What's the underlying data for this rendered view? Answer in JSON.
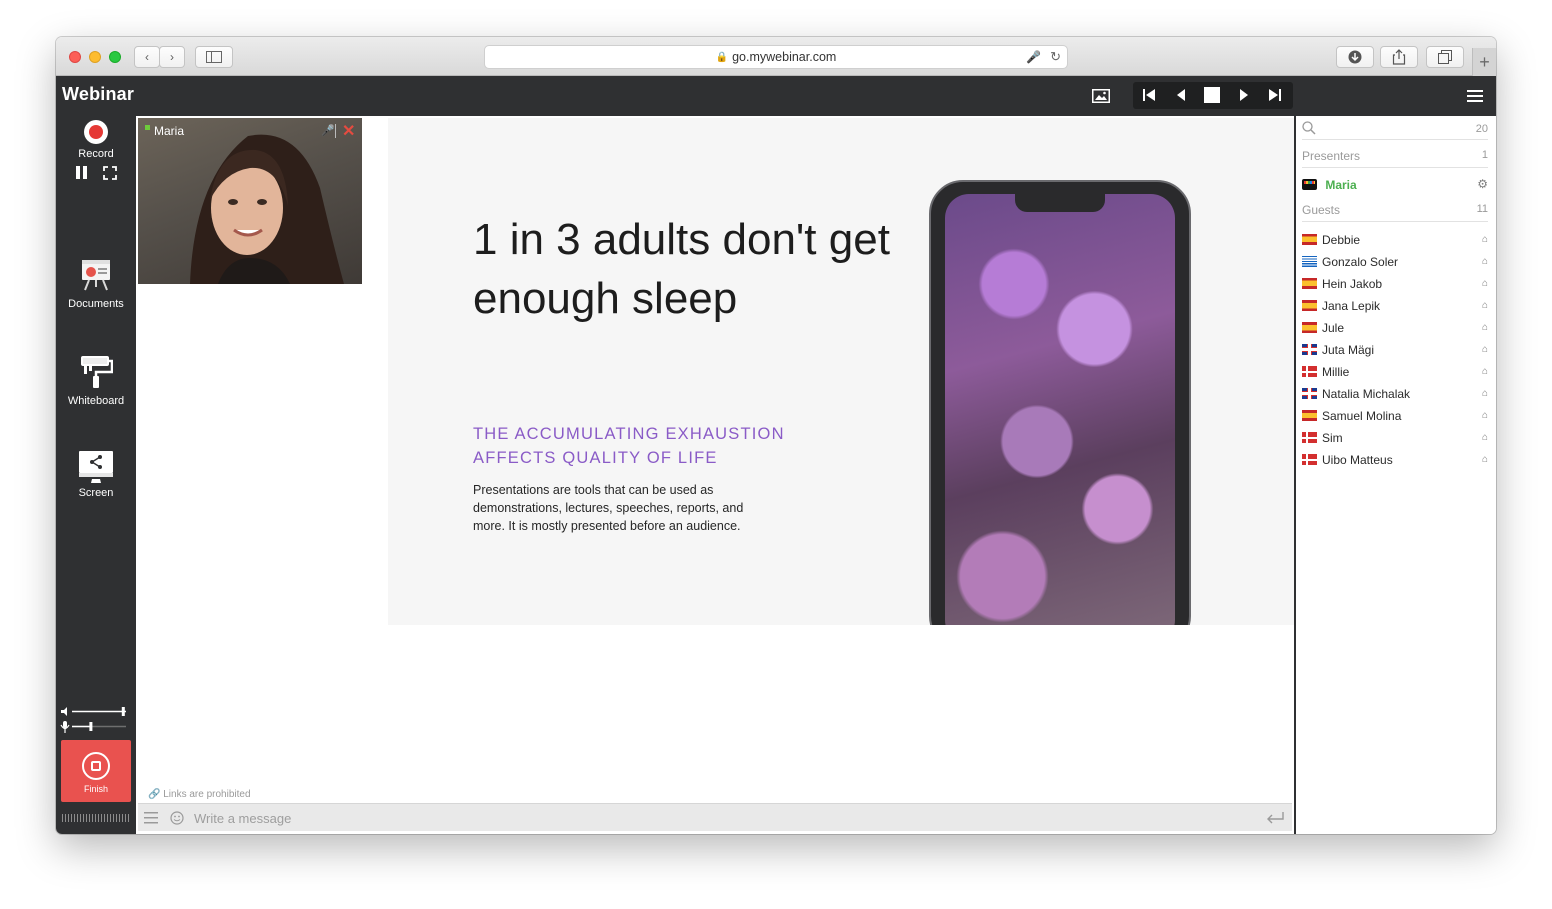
{
  "browser": {
    "url": "go.mywebinar.com"
  },
  "app": {
    "title": "Webinar"
  },
  "sidebar": {
    "record_label": "Record",
    "documents_label": "Documents",
    "whiteboard_label": "Whiteboard",
    "screen_label": "Screen",
    "finish_label": "Finish",
    "speaker_volume": 0.95,
    "mic_volume": 0.35
  },
  "webcam": {
    "name": "Maria"
  },
  "slide": {
    "headline": "1 in 3 adults don't get enough sleep",
    "subheading": "THE ACCUMULATING EXHAUSTION AFFECTS QUALITY OF LIFE",
    "body": "Presentations are tools that can be used as demonstrations, lectures, speeches, reports, and more. It is mostly presented before an audience."
  },
  "chat": {
    "notice": "Links are prohibited",
    "placeholder": "Write a message"
  },
  "participants": {
    "total": "20",
    "presenters_label": "Presenters",
    "presenters_count": "1",
    "presenter": "Maria",
    "guests_label": "Guests",
    "guests_count": "11",
    "guests": [
      {
        "name": "Debbie",
        "flag": "es"
      },
      {
        "name": "Gonzalo Soler",
        "flag": "gr"
      },
      {
        "name": "Hein Jakob",
        "flag": "es"
      },
      {
        "name": "Jana Lepik",
        "flag": "es"
      },
      {
        "name": "Jule",
        "flag": "es"
      },
      {
        "name": "Juta Mägi",
        "flag": "gb"
      },
      {
        "name": "Millie",
        "flag": "dk"
      },
      {
        "name": "Natalia Michalak",
        "flag": "gb"
      },
      {
        "name": "Samuel Molina",
        "flag": "es"
      },
      {
        "name": "Sim",
        "flag": "dk"
      },
      {
        "name": "Uibo Matteus",
        "flag": "dk"
      }
    ]
  },
  "colors": {
    "header_bg": "#2f3032",
    "finish_red": "#e9524f",
    "presenter_green": "#4caf50",
    "subheading_purple": "#8a5bc7"
  }
}
